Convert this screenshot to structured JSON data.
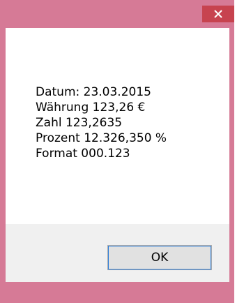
{
  "window": {
    "close_icon": "close-icon",
    "frame_color": "#d67a96",
    "close_button_color": "#c7434f"
  },
  "message": {
    "lines": [
      "Datum: 23.03.2015",
      "Währung 123,26 €",
      "Zahl 123,2635",
      "Prozent 12.326,350 %",
      "Format 000.123"
    ]
  },
  "buttons": {
    "ok_label": "OK"
  }
}
